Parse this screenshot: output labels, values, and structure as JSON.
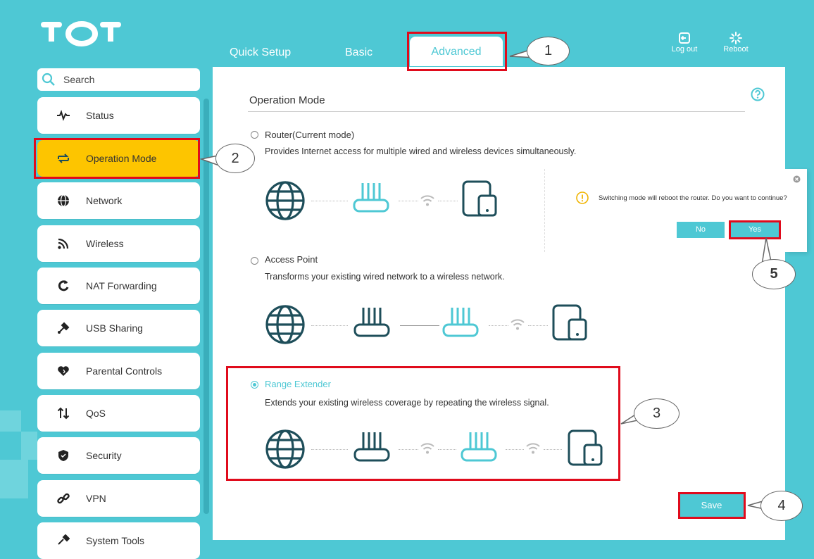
{
  "header": {
    "logo_text": "TOT",
    "tabs": [
      {
        "label": "Quick Setup"
      },
      {
        "label": "Basic"
      },
      {
        "label": "Advanced"
      }
    ],
    "actions": [
      {
        "label": "Log out",
        "icon": "logout-icon"
      },
      {
        "label": "Reboot",
        "icon": "reboot-icon"
      }
    ]
  },
  "sidebar": {
    "search_placeholder": "Search",
    "items": [
      {
        "label": "Status",
        "icon": "pulse-icon"
      },
      {
        "label": "Operation Mode",
        "icon": "switch-arrows-icon",
        "active": true
      },
      {
        "label": "Network",
        "icon": "globe-icon"
      },
      {
        "label": "Wireless",
        "icon": "wifi-icon"
      },
      {
        "label": "NAT Forwarding",
        "icon": "refresh-icon"
      },
      {
        "label": "USB Sharing",
        "icon": "usb-icon"
      },
      {
        "label": "Parental Controls",
        "icon": "heart-icon"
      },
      {
        "label": "QoS",
        "icon": "updown-arrows-icon"
      },
      {
        "label": "Security",
        "icon": "shield-icon"
      },
      {
        "label": "VPN",
        "icon": "link-icon"
      },
      {
        "label": "System Tools",
        "icon": "tools-icon"
      }
    ]
  },
  "main": {
    "title": "Operation Mode",
    "modes": [
      {
        "label": "Router(Current mode)",
        "description": "Provides Internet access for multiple wired and wireless devices simultaneously.",
        "selected": false
      },
      {
        "label": "Access Point",
        "description": "Transforms your existing wired network to a wireless network.",
        "selected": false
      },
      {
        "label": "Range Extender",
        "description": "Extends your existing wireless coverage by repeating the wireless signal.",
        "selected": true
      }
    ],
    "save_label": "Save"
  },
  "dialog": {
    "message": "Switching mode will reboot the router. Do you want to continue?",
    "no_label": "No",
    "yes_label": "Yes"
  },
  "callouts": [
    "1",
    "2",
    "3",
    "4",
    "5"
  ],
  "colors": {
    "accent": "#4ec8d4",
    "active_nav": "#fdc500",
    "highlight": "#e00b1c",
    "icon_dark": "#1e4e5a"
  }
}
